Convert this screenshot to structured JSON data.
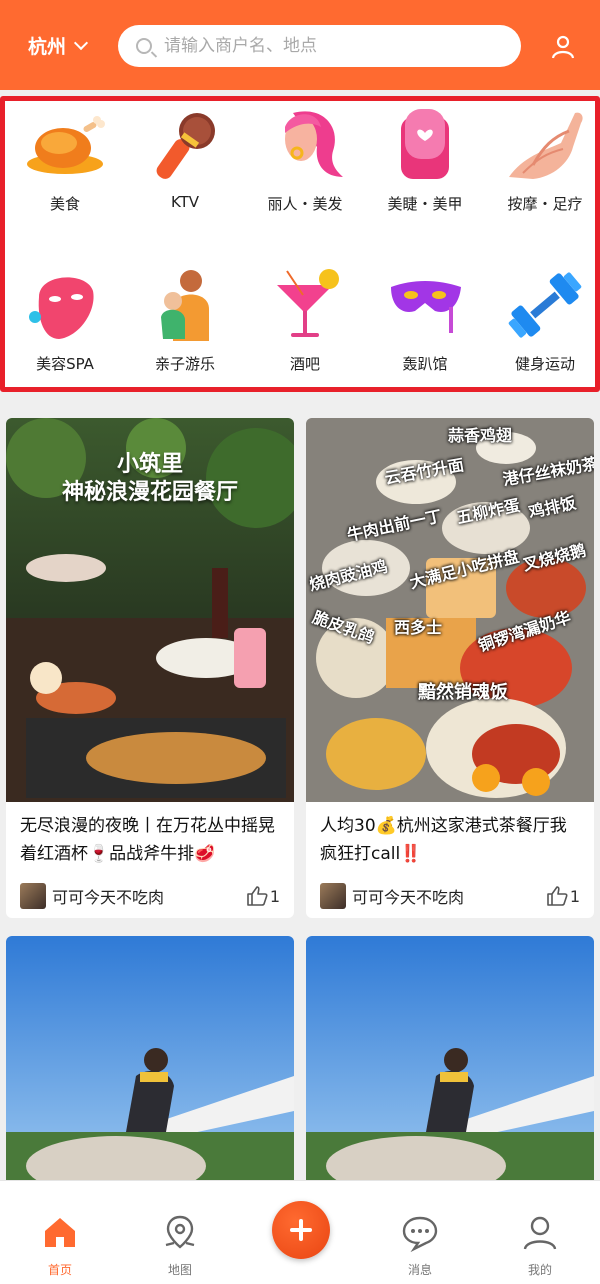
{
  "header": {
    "city": "杭州",
    "search_placeholder": "请输入商户名、地点"
  },
  "categories": [
    {
      "label": "美食",
      "icon": "roast-chicken-icon"
    },
    {
      "label": "KTV",
      "icon": "microphone-icon"
    },
    {
      "label": "丽人・美发",
      "icon": "woman-hair-icon"
    },
    {
      "label": "美睫・美甲",
      "icon": "nail-icon"
    },
    {
      "label": "按摩・足疗",
      "icon": "massage-hand-icon"
    },
    {
      "label": "美容SPA",
      "icon": "face-mask-icon"
    },
    {
      "label": "亲子游乐",
      "icon": "parent-child-icon"
    },
    {
      "label": "酒吧",
      "icon": "cocktail-icon"
    },
    {
      "label": "轰趴馆",
      "icon": "party-mask-icon"
    },
    {
      "label": "健身运动",
      "icon": "dumbbell-icon"
    }
  ],
  "feed": [
    {
      "overlay_line1": "小筑里",
      "overlay_line2": "神秘浪漫花园餐厅",
      "title": "无尽浪漫的夜晚丨在万花丛中摇晃着红酒杯🍷品战斧牛排🥩",
      "author": "可可今天不吃肉",
      "likes": "1"
    },
    {
      "overlay_labels": [
        "蒜香鸡翅",
        "云吞竹升面",
        "港仔丝袜奶茶",
        "牛肉出前一丁",
        "五柳炸蛋",
        "鸡排饭",
        "烧肉豉油鸡",
        "大满足小吃拼盘",
        "叉烧烧鹅",
        "脆皮乳鸽",
        "西多士",
        "铜锣湾漏奶华",
        "黯然销魂饭"
      ],
      "title": "人均30💰杭州这家港式茶餐厅我疯狂打call‼️",
      "author": "可可今天不吃肉",
      "likes": "1"
    }
  ],
  "tabbar": [
    {
      "label": "首页",
      "icon": "home-icon"
    },
    {
      "label": "地图",
      "icon": "map-pin-icon"
    },
    {
      "label": "",
      "icon": "add-icon"
    },
    {
      "label": "消息",
      "icon": "message-icon"
    },
    {
      "label": "我的",
      "icon": "profile-icon"
    }
  ],
  "colors": {
    "brand": "#ff6a30",
    "highlight_border": "#e8202a"
  }
}
